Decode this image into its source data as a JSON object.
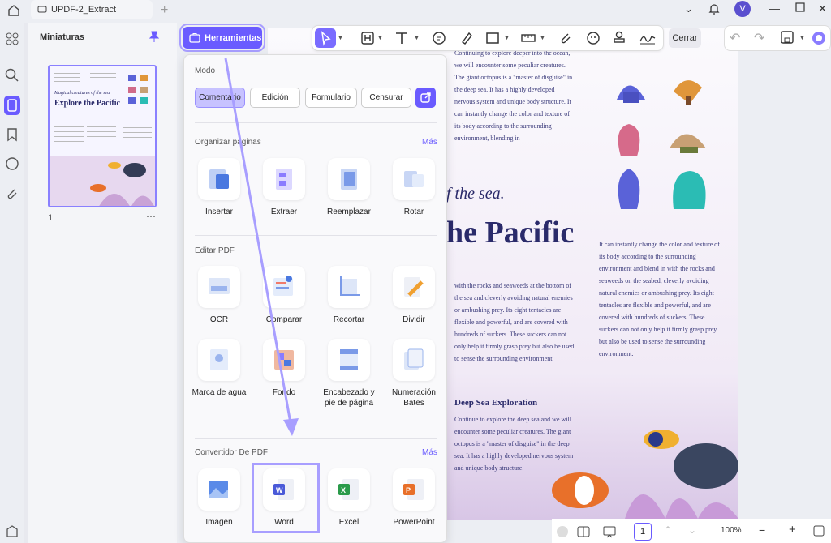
{
  "titlebar": {
    "tab_title": "UPDF-2_Extract",
    "avatar_letter": "V"
  },
  "thumbnails": {
    "title": "Miniaturas",
    "page_number": "1",
    "thumb_title": "Explore the Pacific",
    "thumb_subtitle": "Magical creatures of the sea"
  },
  "toolbar": {
    "tools_button": "Herramientas",
    "close_label": "Cerrar"
  },
  "panel": {
    "mode_heading": "Modo",
    "modes": [
      "Comentario",
      "Edición",
      "Formulario",
      "Censurar"
    ],
    "organize_heading": "Organizar páginas",
    "more": "Más",
    "organize_tools": [
      "Insertar",
      "Extraer",
      "Reemplazar",
      "Rotar"
    ],
    "edit_heading": "Editar PDF",
    "edit_tools": [
      "OCR",
      "Comparar",
      "Recortar",
      "Dividir",
      "Marca de agua",
      "Fondo",
      "Encabezado y pie de página",
      "Numeración Bates"
    ],
    "converter_heading": "Convertidor De PDF",
    "converter_tools": [
      "Imagen",
      "Word",
      "Excel",
      "PowerPoint"
    ]
  },
  "document": {
    "para1": "Continuing to explore deeper into the ocean, we will encounter some peculiar creatures. The giant octopus is a \"master of disguise\" in the deep sea. It has a highly developed nervous system and unique body structure. It can instantly change the color and texture of its body according to the surrounding environment, blending in",
    "of_sea": "f the sea.",
    "big_title": "he Pacific",
    "para2": "with the rocks and seaweeds at the bottom of the sea and cleverly avoiding natural enemies or ambushing prey. Its eight tentacles are flexible and powerful, and are covered with hundreds of suckers. These suckers can not only help it firmly grasp prey but also be used to sense the surrounding environment.",
    "para3": "It can instantly change the color and texture of its body according to the surrounding environment and blend in with the rocks and seaweeds on the seabed, cleverly avoiding natural enemies or ambushing prey. Its eight tentacles are flexible and powerful, and are covered with hundreds of suckers. These suckers can not only help it firmly grasp prey but also be used to sense the surrounding environment.",
    "deep_heading": "Deep Sea Exploration",
    "para4": "Continue to explore the deep sea and we will encounter some peculiar creatures. The giant octopus is a \"master of disguise\" in the deep sea. It has a highly developed nervous system and unique body structure."
  },
  "bottombar": {
    "page": "1",
    "zoom": "100%"
  },
  "colors": {
    "accent": "#6a5bff",
    "highlight": "#a89eff"
  }
}
